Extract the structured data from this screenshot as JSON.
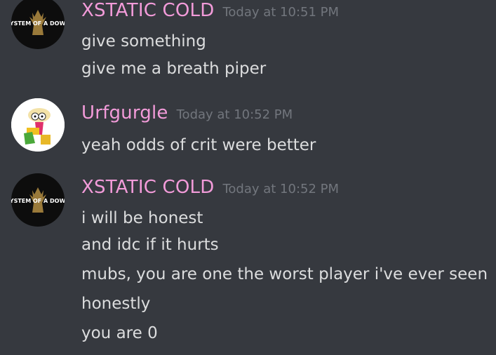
{
  "messages": [
    {
      "username": "XSTATIC COLD",
      "timestamp": "Today at 10:51 PM",
      "avatar_text": "SYSTEM OF A DOWN",
      "lines": [
        "give something",
        "give me a breath piper"
      ]
    },
    {
      "username": "Urfgurgle",
      "timestamp": "Today at 10:52 PM",
      "lines": [
        "yeah odds of crit were better"
      ]
    },
    {
      "username": "XSTATIC COLD",
      "timestamp": "Today at 10:52 PM",
      "avatar_text": "SYSTEM OF A DOWN",
      "lines": [
        "i will be honest",
        "and idc if it hurts",
        "mubs, you are one the worst player i've ever seen",
        "honestly",
        "you are 0"
      ]
    }
  ],
  "colors": {
    "background": "#36393f",
    "username": "#f29bd9",
    "timestamp": "#72767d",
    "text": "#dcddde"
  }
}
